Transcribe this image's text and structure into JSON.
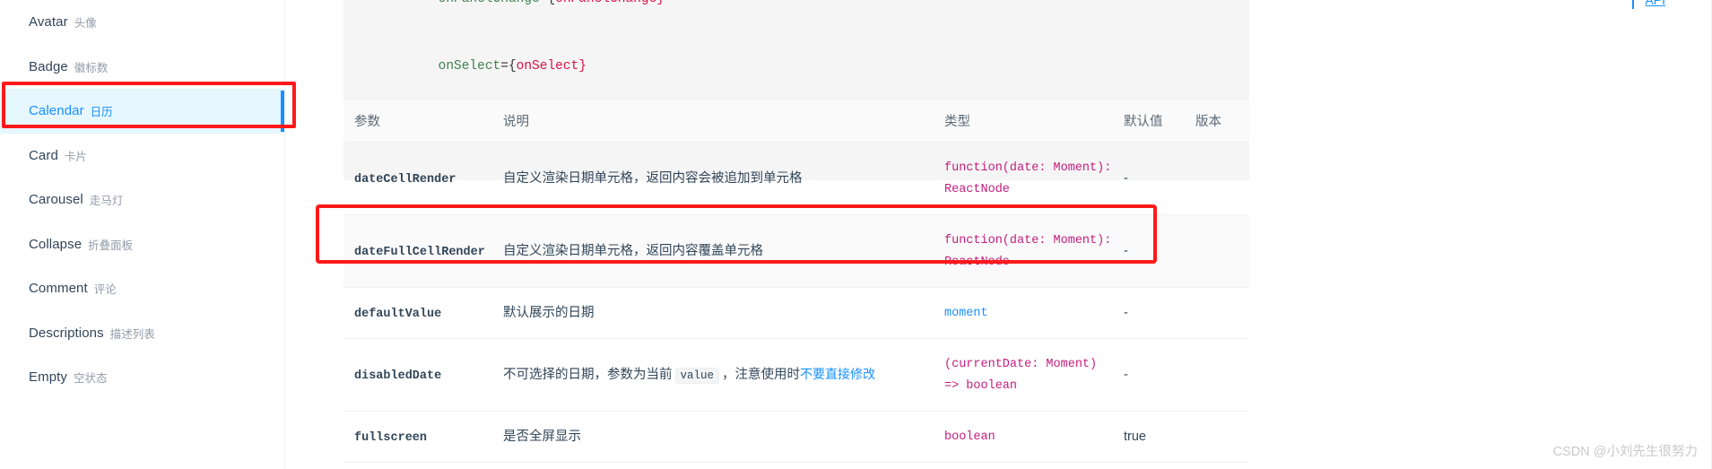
{
  "sidebar": {
    "items": [
      {
        "en": "Avatar",
        "cn": "头像",
        "active": false
      },
      {
        "en": "Badge",
        "cn": "徽标数",
        "active": false
      },
      {
        "en": "Calendar",
        "cn": "日历",
        "active": true
      },
      {
        "en": "Card",
        "cn": "卡片",
        "active": false
      },
      {
        "en": "Carousel",
        "cn": "走马灯",
        "active": false
      },
      {
        "en": "Collapse",
        "cn": "折叠面板",
        "active": false
      },
      {
        "en": "Comment",
        "cn": "评论",
        "active": false
      },
      {
        "en": "Descriptions",
        "cn": "描述列表",
        "active": false
      },
      {
        "en": "Empty",
        "cn": "空状态",
        "active": false
      }
    ]
  },
  "code_block": {
    "lines": [
      {
        "attr": "onPanelChange",
        "eq": "={",
        "val": "onPanelChange",
        "close": "}"
      },
      {
        "attr": "onSelect",
        "eq": "={",
        "val": "onSelect",
        "close": "}"
      }
    ],
    "closing_tag": "/>"
  },
  "api_table": {
    "headers": [
      "参数",
      "说明",
      "类型",
      "默认值",
      "版本"
    ],
    "rows": [
      {
        "param": "dateCellRender",
        "desc": "自定义渲染日期单元格，返回内容会被追加到单元格",
        "type": "function(date: Moment): ReactNode",
        "default": "-",
        "version": "",
        "highlighted": false
      },
      {
        "param": "dateFullCellRender",
        "desc": "自定义渲染日期单元格，返回内容覆盖单元格",
        "type": "function(date: Moment): ReactNode",
        "default": "-",
        "version": "",
        "highlighted": true
      },
      {
        "param": "defaultValue",
        "desc": "默认展示的日期",
        "type": "moment",
        "type_style": "blue",
        "default": "-",
        "version": "",
        "highlighted": false
      },
      {
        "param": "disabledDate",
        "desc_prefix": "不可选择的日期，参数为当前",
        "desc_code": "value",
        "desc_mid": "，注意使用时",
        "desc_link": "不要直接修改",
        "type": "(currentDate: Moment) => boolean",
        "default": "-",
        "version": "",
        "highlighted": false
      },
      {
        "param": "fullscreen",
        "desc": "是否全屏显示",
        "type": "boolean",
        "default": "true",
        "version": "",
        "highlighted": false
      }
    ]
  },
  "anchor_nav": {
    "link_label": "API"
  },
  "watermark": {
    "text": "CSDN @小刘先生很努力"
  },
  "colors": {
    "accent": "#1890ff",
    "annotation": "#ff1a1a",
    "active_bg": "#e6f7ff",
    "type_pink": "#c41d7f",
    "header_bg": "#fafafa"
  }
}
